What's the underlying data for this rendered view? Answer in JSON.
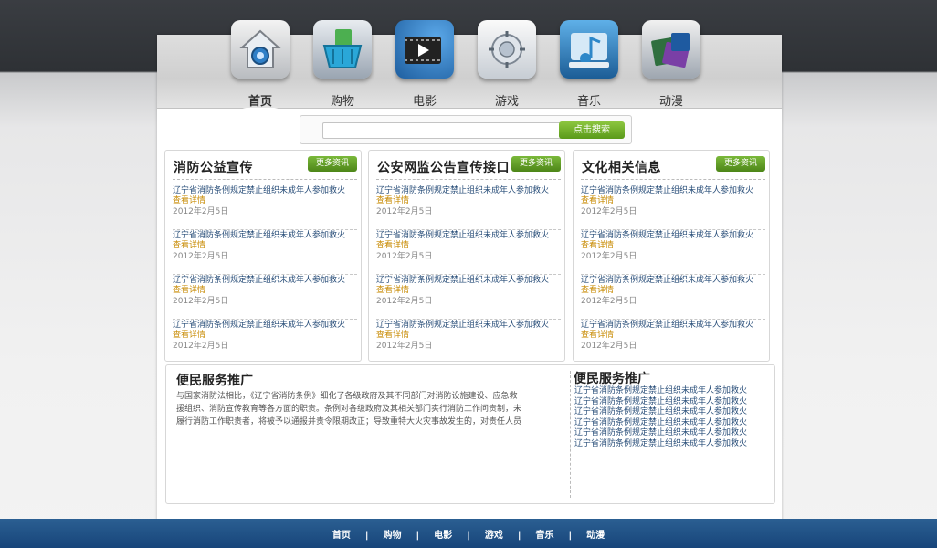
{
  "nav": {
    "items": [
      {
        "label": "首页",
        "icon": "home-icon"
      },
      {
        "label": "购物",
        "icon": "shopping-basket-icon"
      },
      {
        "label": "电影",
        "icon": "film-icon"
      },
      {
        "label": "游戏",
        "icon": "gamepad-icon"
      },
      {
        "label": "音乐",
        "icon": "music-icon"
      },
      {
        "label": "动漫",
        "icon": "anime-icon"
      }
    ],
    "active": "首页"
  },
  "search": {
    "placeholder": "",
    "button_label": "点击搜索"
  },
  "panels": [
    {
      "title": "消防公益宣传",
      "more_label": "更多资讯",
      "items": [
        {
          "title": "辽宁省消防条例规定禁止组织未成年人参加救火",
          "detail": "查看详情",
          "date": "2012年2月5日"
        },
        {
          "title": "辽宁省消防条例规定禁止组织未成年人参加救火",
          "detail": "查看详情",
          "date": "2012年2月5日"
        },
        {
          "title": "辽宁省消防条例规定禁止组织未成年人参加救火",
          "detail": "查看详情",
          "date": "2012年2月5日"
        },
        {
          "title": "辽宁省消防条例规定禁止组织未成年人参加救火",
          "detail": "查看详情",
          "date": "2012年2月5日"
        }
      ]
    },
    {
      "title": "公安网监公告宣传接口",
      "more_label": "更多资讯",
      "items": [
        {
          "title": "辽宁省消防条例规定禁止组织未成年人参加救火",
          "detail": "查看详情",
          "date": "2012年2月5日"
        },
        {
          "title": "辽宁省消防条例规定禁止组织未成年人参加救火",
          "detail": "查看详情",
          "date": "2012年2月5日"
        },
        {
          "title": "辽宁省消防条例规定禁止组织未成年人参加救火",
          "detail": "查看详情",
          "date": "2012年2月5日"
        },
        {
          "title": "辽宁省消防条例规定禁止组织未成年人参加救火",
          "detail": "查看详情",
          "date": "2012年2月5日"
        }
      ]
    },
    {
      "title": "文化相关信息",
      "more_label": "更多资讯",
      "items": [
        {
          "title": "辽宁省消防条例规定禁止组织未成年人参加救火",
          "detail": "查看详情",
          "date": "2012年2月5日"
        },
        {
          "title": "辽宁省消防条例规定禁止组织未成年人参加救火",
          "detail": "查看详情",
          "date": "2012年2月5日"
        },
        {
          "title": "辽宁省消防条例规定禁止组织未成年人参加救火",
          "detail": "查看详情",
          "date": "2012年2月5日"
        },
        {
          "title": "辽宁省消防条例规定禁止组织未成年人参加救火",
          "detail": "查看详情",
          "date": "2012年2月5日"
        }
      ]
    }
  ],
  "service_left": {
    "title": "便民服务推广",
    "text": "与国家消防法相比，《辽宁省消防条例》细化了各级政府及其不同部门对消防设施建设、应急救援组织、消防宣传教育等各方面的职责。条例对各级政府及其相关部门实行消防工作问责制，未履行消防工作职责者，将被予以通报并责令限期改正；导致重特大火灾事故发生的，对责任人员"
  },
  "service_right": {
    "title": "便民服务推广",
    "items": [
      "辽宁省消防条例规定禁止组织未成年人参加救火",
      "辽宁省消防条例规定禁止组织未成年人参加救火",
      "辽宁省消防条例规定禁止组织未成年人参加救火",
      "辽宁省消防条例规定禁止组织未成年人参加救火",
      "辽宁省消防条例规定禁止组织未成年人参加救火",
      "辽宁省消防条例规定禁止组织未成年人参加救火"
    ]
  },
  "footer": {
    "links": [
      "首页",
      "购物",
      "电影",
      "游戏",
      "音乐",
      "动漫"
    ],
    "separator": "|"
  },
  "colors": {
    "accent_green": "#6aa82a",
    "link_blue": "#2a4f7a",
    "detail_orange": "#c78a00",
    "footer_blue": "#1f4f84"
  }
}
